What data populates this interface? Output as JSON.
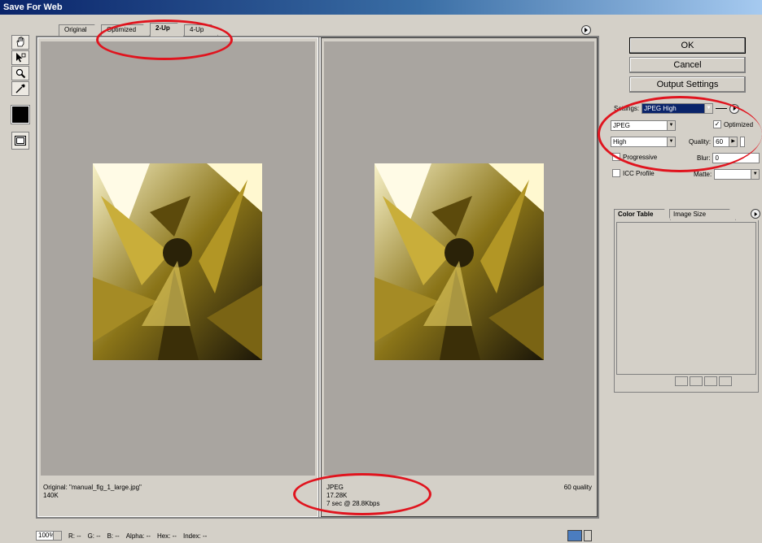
{
  "window": {
    "title": "Save For Web"
  },
  "tabs": [
    {
      "label": "Original"
    },
    {
      "label": "Optimized"
    },
    {
      "label": "2-Up"
    },
    {
      "label": "4-Up"
    }
  ],
  "panes": {
    "left": {
      "line1": "Original: \"manual_fig_1_large.jpg\"",
      "line2": "140K"
    },
    "right": {
      "line1": "JPEG",
      "line2": "17.28K",
      "line3": "7 sec @ 28.8Kbps",
      "quality": "60 quality"
    }
  },
  "buttons": {
    "ok": "OK",
    "cancel": "Cancel",
    "output": "Output Settings"
  },
  "settings": {
    "settings_label": "Settings:",
    "preset": "JPEG High",
    "format": "JPEG",
    "optimized": "Optimized",
    "compression": "High",
    "quality_label": "Quality:",
    "quality_value": "60",
    "progressive": "Progressive",
    "blur_label": "Blur:",
    "blur_value": "0",
    "icc": "ICC Profile",
    "matte_label": "Matte:"
  },
  "side_tabs": {
    "color_table": "Color Table",
    "image_size": "Image Size"
  },
  "status": {
    "zoom": "100%",
    "r": "R:",
    "r_val": "--",
    "g": "G:",
    "g_val": "--",
    "b": "B:",
    "b_val": "--",
    "alpha": "Alpha:",
    "alpha_val": "--",
    "hex": "Hex:",
    "hex_val": "--",
    "index": "Index:",
    "index_val": "--"
  },
  "colors": {
    "annotation": "#e0141e",
    "canvas": "#a9a5a0",
    "title_bar": "#0a246a"
  }
}
